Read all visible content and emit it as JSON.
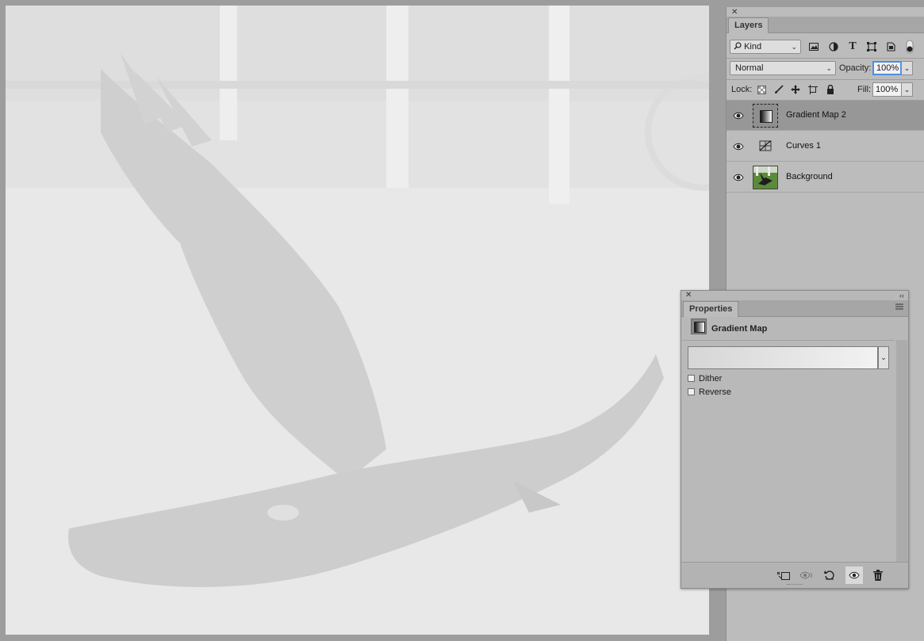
{
  "layers_panel": {
    "tab": "Layers",
    "filter_kind": "Kind",
    "blend_mode": "Normal",
    "opacity_label": "Opacity:",
    "opacity_value": "100%",
    "lock_label": "Lock:",
    "fill_label": "Fill:",
    "fill_value": "100%",
    "layers": [
      {
        "name": "Gradient Map 2",
        "selected": true,
        "visible": true,
        "thumb": "gradient-map"
      },
      {
        "name": "Curves 1",
        "selected": false,
        "visible": true,
        "thumb": "curves"
      },
      {
        "name": "Background",
        "selected": false,
        "visible": true,
        "thumb": "photo"
      }
    ]
  },
  "properties_panel": {
    "tab": "Properties",
    "title": "Gradient Map",
    "dither_label": "Dither",
    "dither_checked": false,
    "reverse_label": "Reverse",
    "reverse_checked": false
  },
  "colors": {
    "panel_bg": "#bcbcbc",
    "selected_layer": "#979797",
    "focus_ring": "#4a8fe0",
    "canvas_bg": "#e6e6e6"
  },
  "icons": {
    "filter_icons": [
      "image-filter-icon",
      "adjustment-filter-icon",
      "type-filter-icon",
      "shape-filter-icon",
      "smart-object-filter-icon",
      "filter-toggle-icon"
    ],
    "lock_icons": [
      "lock-transparent-pixels-icon",
      "lock-image-pixels-icon",
      "lock-position-icon",
      "lock-artboard-icon",
      "lock-all-icon"
    ],
    "footer_icons": [
      "clip-to-layer-icon",
      "view-previous-state-icon",
      "reset-icon",
      "visibility-icon",
      "delete-icon"
    ]
  }
}
